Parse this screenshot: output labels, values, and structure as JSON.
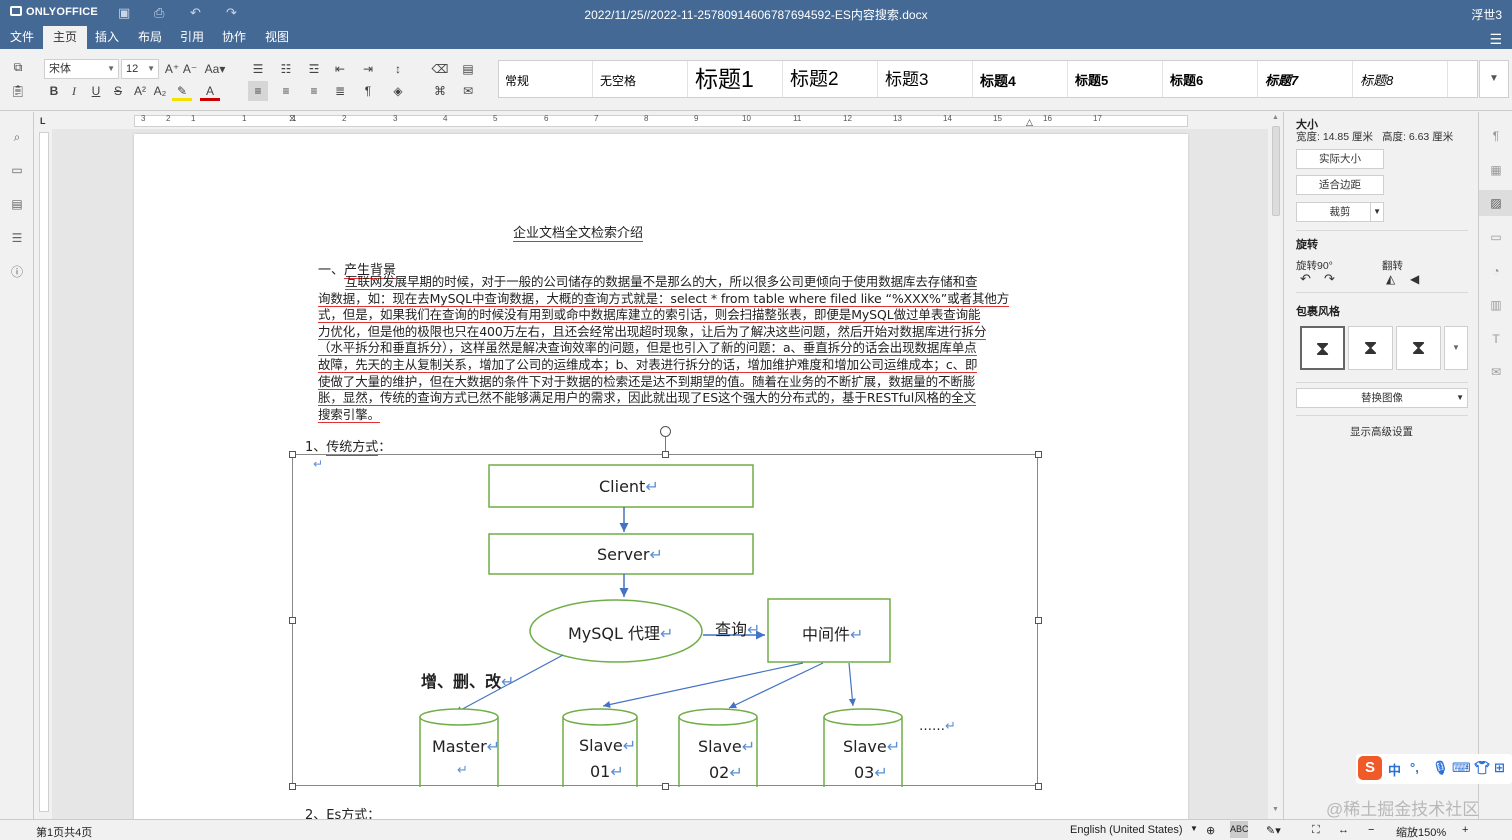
{
  "titlebar": {
    "app_name": "ONLYOFFICE",
    "doc_title": "2022/11/25//2022-11-25780914606787694592-ES内容搜索.docx",
    "user": "浮世3"
  },
  "menu": {
    "tabs": [
      "文件",
      "主页",
      "插入",
      "布局",
      "引用",
      "协作",
      "视图"
    ],
    "active": "主页"
  },
  "toolbar": {
    "font_name": "宋体",
    "font_size": "12"
  },
  "styles": [
    "常规",
    "无空格",
    "标题1",
    "标题2",
    "标题3",
    "标题4",
    "标题5",
    "标题6",
    "标题7",
    "标题8"
  ],
  "ruler": {
    "numbers": [
      "3",
      "2",
      "1",
      "1",
      "1",
      "2",
      "3",
      "4",
      "5",
      "6",
      "7",
      "8",
      "9",
      "10",
      "11",
      "12",
      "13",
      "14",
      "15",
      "16",
      "17"
    ]
  },
  "document": {
    "title": "企业文档全文检索介绍",
    "section1_num": "一、",
    "section1": "产生背景",
    "para_lines": [
      "互联网发展早期的时候，对于一般的公司储存的数据量不是那么的大，所以很多公司更倾向于使用数据库去存储和查",
      "询数据，如：现在去MySQL中查询数据，大概的查询方式就是：select * from table where filed like “%XXX%”或者其他方",
      "式，但是，如果我们在查询的时候没有用到或命中数据库建立的索引话，则会扫描整张表，即便是MySQL做过单表查询能",
      "力优化，但是他的极限也只在400万左右，且还会经常出现超时现象，让后为了解决这些问题，然后开始对数据库进行拆分",
      "（水平拆分和垂直拆分），这样虽然是解决查询效率的问题，但是也引入了新的问题：a、垂直拆分的话会出现数据库单点",
      "故障，先天的主从复制关系，增加了公司的运维成本；b、对表进行拆分的话，增加维护难度和增加公司运维成本；c、即",
      "使做了大量的维护，但在大数据的条件下对于数据的检索还是达不到期望的值。随着在业务的不断扩展，数据量的不断膨",
      "胀，显然，传统的查询方式已然不能够满足用户的需求，因此就出现了ES这个强大的分布式的，基于RESTful风格的全文",
      "搜索引擎。"
    ],
    "item1_num": "1、",
    "item1": "传统方式",
    "item1_colon": "：",
    "item2_num": "2、",
    "item2": "Es方式",
    "item2_colon": "：",
    "para_mark": "↵"
  },
  "diagram": {
    "client": "Client",
    "server": "Server",
    "proxy": "MySQL 代理",
    "query": "查询",
    "middleware": "中间件",
    "crud": "增、删、改",
    "master": "Master",
    "slave1_a": "Slave",
    "slave1_b": "01",
    "slave2_a": "Slave",
    "slave2_b": "02",
    "slave3_a": "Slave",
    "slave3_b": "03",
    "ellipsis": "……",
    "mark": "↵"
  },
  "right_panel": {
    "size_title": "大小",
    "width_label": "宽度: 14.85 厘米",
    "height_label": "高度: 6.63 厘米",
    "actual_size": "实际大小",
    "fit_margin": "适合边距",
    "crop": "裁剪",
    "rotation_title": "旋转",
    "rotate90": "旋转90°",
    "flip": "翻转",
    "wrap_title": "包裹风格",
    "replace_image": "替换图像",
    "advanced": "显示高级设置"
  },
  "status": {
    "page": "第1页共4页",
    "language": "English (United States)",
    "zoom": "缩放150%"
  },
  "ime": {
    "label": "中"
  },
  "watermark": "@稀土掘金技术社区"
}
